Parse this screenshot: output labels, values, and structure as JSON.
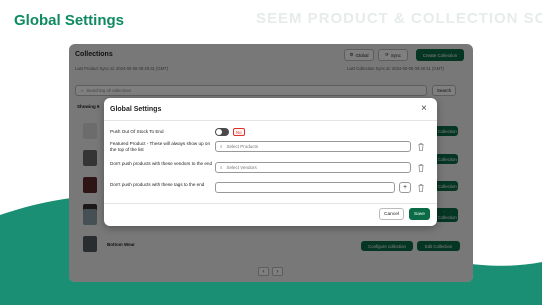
{
  "page": {
    "heading": "Global Settings",
    "watermark": "SEEM PRODUCT & COLLECTION SORT"
  },
  "app": {
    "title": "Collections",
    "global_label": "Global",
    "sync_label": "Sync",
    "create_label": "Create Collection",
    "last_product_sync": "Last Product Sync at: 2024-05-08 08:49:31 (GMT)",
    "last_collection_sync": "Last Collection Sync at: 2024-05-08 08:49:31 (GMT)",
    "search_placeholder": "Searching all collections",
    "search_button": "Search",
    "showing_text": "Showing 6",
    "row_buttons": [
      "Edit Collection",
      "Edit Collection",
      "Edit Collection",
      "Edit Collection",
      "Edit Collection"
    ],
    "last_row": {
      "name": "Bottom Wear",
      "configure_label": "Configure collection",
      "edit_label": "Edit Collection"
    },
    "pager_prev": "‹",
    "pager_next": "›"
  },
  "modal": {
    "title": "Global Settings",
    "close_glyph": "×",
    "push_out_of_stock_label": "Push Out Of Stock To End",
    "push_out_of_stock_state": "No",
    "featured_label": "Featured Product - These will always show up on the top of the list",
    "featured_placeholder": "Select Products",
    "vendors_label": "Don't push products with these vendors to the end",
    "vendors_placeholder": "Select Vendors",
    "tags_label": "Don't push products with these tags to the end",
    "tags_value": "",
    "plus_glyph": "+",
    "cancel_label": "Cancel",
    "save_label": "Save"
  },
  "colors": {
    "brand_green": "#0b6b47",
    "heading_green": "#0f8a62",
    "wave_green": "#1a8f73",
    "badge_red": "#d9342b"
  }
}
